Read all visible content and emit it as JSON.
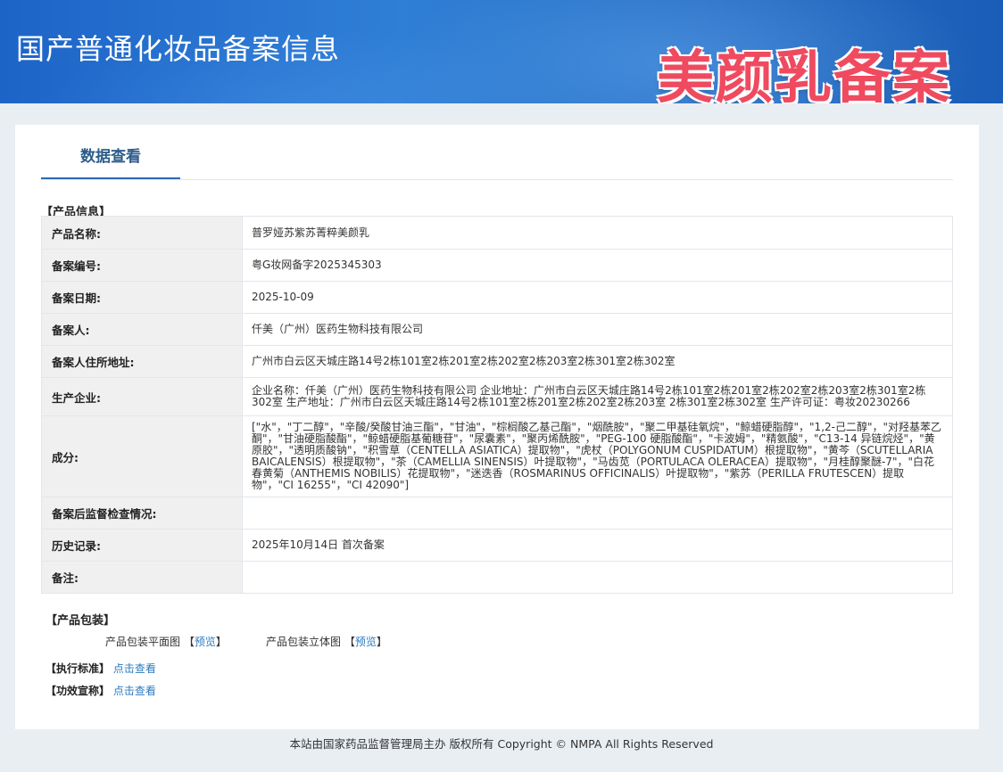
{
  "header": {
    "site_title": "国产普通化妆品备案信息",
    "watermark": "美颜乳备案",
    "watermark_color": "#ef4a5f"
  },
  "tab": {
    "label": "数据查看"
  },
  "product_info": {
    "section_title": "【产品信息】",
    "rows": [
      {
        "key": "产品名称:",
        "value": "普罗娅苏紫苏菁粹美颜乳"
      },
      {
        "key": "备案编号:",
        "value": "粤G妆网备字2025345303"
      },
      {
        "key": "备案日期:",
        "value": "2025-10-09"
      },
      {
        "key": "备案人:",
        "value": "仟美（广州）医药生物科技有限公司"
      },
      {
        "key": "备案人住所地址:",
        "value": "广州市白云区天城庄路14号2栋101室2栋201室2栋202室2栋203室2栋301室2栋302室"
      },
      {
        "key": "生产企业:",
        "value": "企业名称：仟美（广州）医药生物科技有限公司 企业地址：广州市白云区天城庄路14号2栋101室2栋201室2栋202室2栋203室2栋301室2栋302室 生产地址：广州市白云区天城庄路14号2栋101室2栋201室2栋202室2栋203室 2栋301室2栋302室 生产许可证：粤妆20230266"
      },
      {
        "key": "成分:",
        "value": "[\"水\"，\"丁二醇\"，\"辛酸/癸酸甘油三酯\"，\"甘油\"，\"棕榈酸乙基己酯\"，\"烟酰胺\"，\"聚二甲基硅氧烷\"，\"鲸蜡硬脂醇\"，\"1,2-己二醇\"，\"对羟基苯乙酮\"，\"甘油硬脂酸酯\"，\"鲸蜡硬脂基葡糖苷\"，\"尿囊素\"，\"聚丙烯酰胺\"，\"PEG-100 硬脂酸酯\"，\"卡波姆\"，\"精氨酸\"，\"C13-14 异链烷烃\"，\"黄原胶\"，\"透明质酸钠\"，\"积雪草（CENTELLA ASIATICA）提取物\"，\"虎杖（POLYGONUM CUSPIDATUM）根提取物\"，\"黄芩（SCUTELLARIA BAICALENSIS）根提取物\"，\"茶（CAMELLIA SINENSIS）叶提取物\"，\"马齿苋（PORTULACA OLERACEA）提取物\"，\"月桂醇聚醚-7\"，\"白花春黄菊（ANTHEMIS NOBILIS）花提取物\"，\"迷迭香（ROSMARINUS OFFICINALIS）叶提取物\"，\"紫苏（PERILLA FRUTESCEN）提取物\"，\"CI 16255\"，\"CI 42090\"]"
      },
      {
        "key": "备案后监督检查情况:",
        "value": ""
      },
      {
        "key": "历史记录:",
        "value": "2025年10月14日 首次备案"
      },
      {
        "key": "备注:",
        "value": ""
      }
    ]
  },
  "packaging": {
    "section_title": "【产品包装】",
    "flat_label": "产品包装平面图",
    "solid_label": "产品包装立体图",
    "preview_link": "预览",
    "bracket_open": "【",
    "bracket_close": "】"
  },
  "standard": {
    "label": "【执行标准】",
    "link": "点击查看"
  },
  "efficacy": {
    "label": "【功效宣称】",
    "link": "点击查看"
  },
  "footer": {
    "text": "本站由国家药品监督管理局主办 版权所有 Copyright © NMPA All Rights Reserved"
  }
}
